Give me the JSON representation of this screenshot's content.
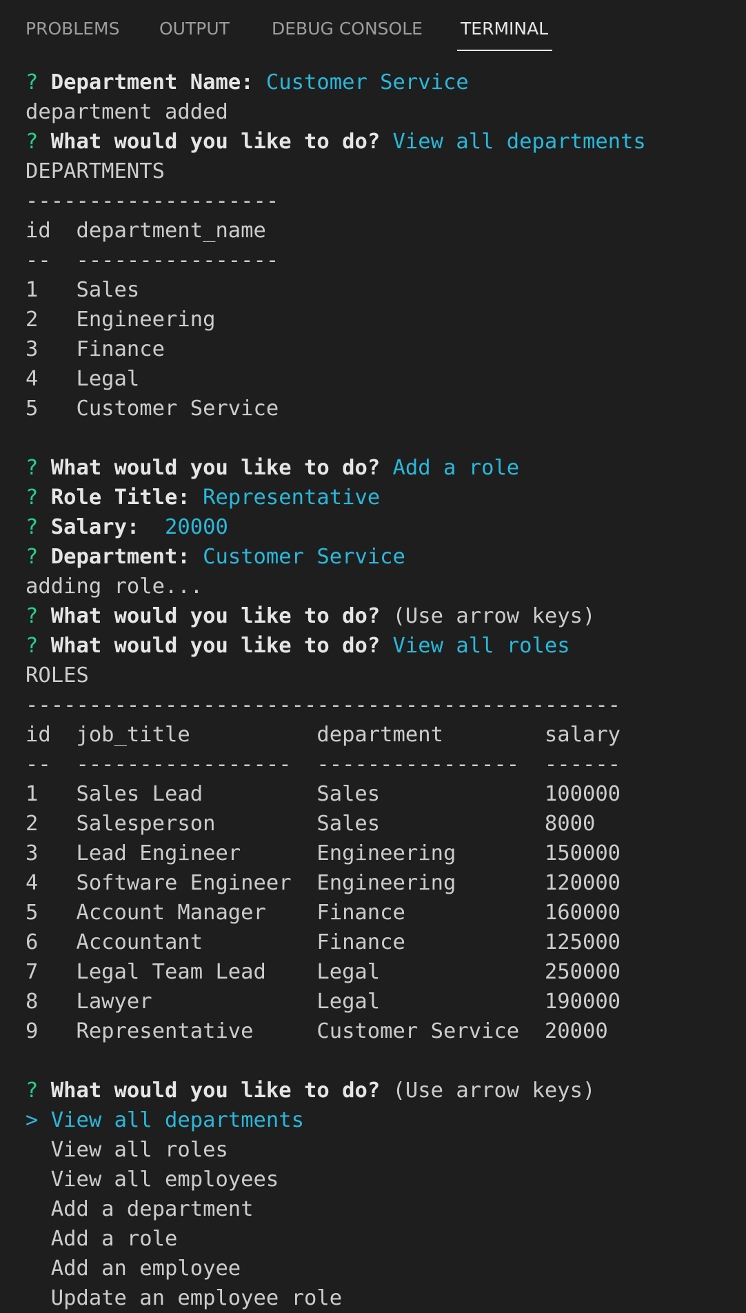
{
  "tabs": [
    {
      "label": "PROBLEMS",
      "active": false
    },
    {
      "label": "OUTPUT",
      "active": false
    },
    {
      "label": "DEBUG CONSOLE",
      "active": false
    },
    {
      "label": "TERMINAL",
      "active": true
    }
  ],
  "colors": {
    "background": "#1e1e1e",
    "prompt_mark": "#23d18b",
    "answer": "#29b8db",
    "text": "#cccccc"
  },
  "terminal": {
    "prompt_mark": "?",
    "q_department_name": "Department Name: ",
    "a_department_name": "Customer Service",
    "msg_department_added": "department added",
    "q_what_to_do": "What would you like to do? ",
    "a_view_all_departments": "View all departments",
    "departments_title": "DEPARTMENTS",
    "departments_rule": "--------------------",
    "departments_header": "id  department_name",
    "departments_header_rule": "--  ----------------",
    "departments_rows": [
      "1   Sales",
      "2   Engineering",
      "3   Finance",
      "4   Legal",
      "5   Customer Service"
    ],
    "a_add_role": "Add a role",
    "q_role_title": "Role Title: ",
    "a_role_title": "Representative",
    "q_salary": "Salary: ",
    "a_salary": " 20000",
    "q_department": "Department: ",
    "a_department": "Customer Service",
    "msg_adding_role": "adding role...",
    "hint_arrow_keys": "(Use arrow keys)",
    "a_view_all_roles": "View all roles",
    "roles_title": "ROLES",
    "roles_rule": "-----------------------------------------------",
    "roles_header": "id  job_title          department        salary",
    "roles_header_rule": "--  -----------------  ----------------  ------",
    "roles_rows": [
      "1   Sales Lead         Sales             100000",
      "2   Salesperson        Sales             8000",
      "3   Lead Engineer      Engineering       150000",
      "4   Software Engineer  Engineering       120000",
      "5   Account Manager    Finance           160000",
      "6   Accountant         Finance           125000",
      "7   Legal Team Lead    Legal             250000",
      "8   Lawyer             Legal             190000",
      "9   Representative     Customer Service  20000"
    ],
    "menu_pointer": ">",
    "menu_options": [
      "View all departments",
      "View all roles",
      "View all employees",
      "Add a department",
      "Add a role",
      "Add an employee",
      "Update an employee role"
    ]
  }
}
